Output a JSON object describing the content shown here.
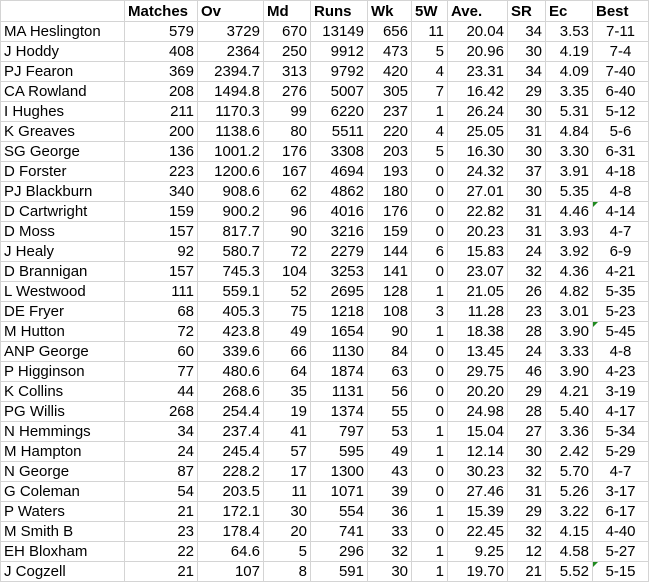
{
  "sheet": {
    "headers": [
      "",
      "Matches",
      "Ov",
      "Md",
      "Runs",
      "Wk",
      "5W",
      "Ave.",
      "SR",
      "Ec",
      "Best"
    ],
    "rows": [
      {
        "name": "MA Heslington",
        "matches": "579",
        "ov": "3729",
        "md": "670",
        "runs": "13149",
        "wk": "656",
        "fivew": "11",
        "ave": "20.04",
        "sr": "34",
        "ec": "3.53",
        "best": "7-11"
      },
      {
        "name": "J Hoddy",
        "matches": "408",
        "ov": "2364",
        "md": "250",
        "runs": "9912",
        "wk": "473",
        "fivew": "5",
        "ave": "20.96",
        "sr": "30",
        "ec": "4.19",
        "best": "7-4"
      },
      {
        "name": "PJ Fearon",
        "matches": "369",
        "ov": "2394.7",
        "md": "313",
        "runs": "9792",
        "wk": "420",
        "fivew": "4",
        "ave": "23.31",
        "sr": "34",
        "ec": "4.09",
        "best": "7-40"
      },
      {
        "name": "CA Rowland",
        "matches": "208",
        "ov": "1494.8",
        "md": "276",
        "runs": "5007",
        "wk": "305",
        "fivew": "7",
        "ave": "16.42",
        "sr": "29",
        "ec": "3.35",
        "best": "6-40"
      },
      {
        "name": "I Hughes",
        "matches": "211",
        "ov": "1170.3",
        "md": "99",
        "runs": "6220",
        "wk": "237",
        "fivew": "1",
        "ave": "26.24",
        "sr": "30",
        "ec": "5.31",
        "best": "5-12"
      },
      {
        "name": "K Greaves",
        "matches": "200",
        "ov": "1138.6",
        "md": "80",
        "runs": "5511",
        "wk": "220",
        "fivew": "4",
        "ave": "25.05",
        "sr": "31",
        "ec": "4.84",
        "best": "5-6"
      },
      {
        "name": "SG George",
        "matches": "136",
        "ov": "1001.2",
        "md": "176",
        "runs": "3308",
        "wk": "203",
        "fivew": "5",
        "ave": "16.30",
        "sr": "30",
        "ec": "3.30",
        "best": "6-31"
      },
      {
        "name": "D Forster",
        "matches": "223",
        "ov": "1200.6",
        "md": "167",
        "runs": "4694",
        "wk": "193",
        "fivew": "0",
        "ave": "24.32",
        "sr": "37",
        "ec": "3.91",
        "best": "4-18"
      },
      {
        "name": "PJ Blackburn",
        "matches": "340",
        "ov": "908.6",
        "md": "62",
        "runs": "4862",
        "wk": "180",
        "fivew": "0",
        "ave": "27.01",
        "sr": "30",
        "ec": "5.35",
        "best": "4-8"
      },
      {
        "name": "D Cartwright",
        "matches": "159",
        "ov": "900.2",
        "md": "96",
        "runs": "4016",
        "wk": "176",
        "fivew": "0",
        "ave": "22.82",
        "sr": "31",
        "ec": "4.46",
        "best": "4-14",
        "flag": true
      },
      {
        "name": "D Moss",
        "matches": "157",
        "ov": "817.7",
        "md": "90",
        "runs": "3216",
        "wk": "159",
        "fivew": "0",
        "ave": "20.23",
        "sr": "31",
        "ec": "3.93",
        "best": "4-7"
      },
      {
        "name": "J Healy",
        "matches": "92",
        "ov": "580.7",
        "md": "72",
        "runs": "2279",
        "wk": "144",
        "fivew": "6",
        "ave": "15.83",
        "sr": "24",
        "ec": "3.92",
        "best": "6-9"
      },
      {
        "name": "D Brannigan",
        "matches": "157",
        "ov": "745.3",
        "md": "104",
        "runs": "3253",
        "wk": "141",
        "fivew": "0",
        "ave": "23.07",
        "sr": "32",
        "ec": "4.36",
        "best": "4-21"
      },
      {
        "name": "L Westwood",
        "matches": "111",
        "ov": "559.1",
        "md": "52",
        "runs": "2695",
        "wk": "128",
        "fivew": "1",
        "ave": "21.05",
        "sr": "26",
        "ec": "4.82",
        "best": "5-35"
      },
      {
        "name": "DE Fryer",
        "matches": "68",
        "ov": "405.3",
        "md": "75",
        "runs": "1218",
        "wk": "108",
        "fivew": "3",
        "ave": "11.28",
        "sr": "23",
        "ec": "3.01",
        "best": "5-23"
      },
      {
        "name": "M Hutton",
        "matches": "72",
        "ov": "423.8",
        "md": "49",
        "runs": "1654",
        "wk": "90",
        "fivew": "1",
        "ave": "18.38",
        "sr": "28",
        "ec": "3.90",
        "best": "5-45",
        "flag": true
      },
      {
        "name": "ANP George",
        "matches": "60",
        "ov": "339.6",
        "md": "66",
        "runs": "1130",
        "wk": "84",
        "fivew": "0",
        "ave": "13.45",
        "sr": "24",
        "ec": "3.33",
        "best": "4-8"
      },
      {
        "name": "P Higginson",
        "matches": "77",
        "ov": "480.6",
        "md": "64",
        "runs": "1874",
        "wk": "63",
        "fivew": "0",
        "ave": "29.75",
        "sr": "46",
        "ec": "3.90",
        "best": "4-23"
      },
      {
        "name": "K Collins",
        "matches": "44",
        "ov": "268.6",
        "md": "35",
        "runs": "1131",
        "wk": "56",
        "fivew": "0",
        "ave": "20.20",
        "sr": "29",
        "ec": "4.21",
        "best": "3-19"
      },
      {
        "name": "PG Willis",
        "matches": "268",
        "ov": "254.4",
        "md": "19",
        "runs": "1374",
        "wk": "55",
        "fivew": "0",
        "ave": "24.98",
        "sr": "28",
        "ec": "5.40",
        "best": "4-17"
      },
      {
        "name": "N Hemmings",
        "matches": "34",
        "ov": "237.4",
        "md": "41",
        "runs": "797",
        "wk": "53",
        "fivew": "1",
        "ave": "15.04",
        "sr": "27",
        "ec": "3.36",
        "best": "5-34"
      },
      {
        "name": "M Hampton",
        "matches": "24",
        "ov": "245.4",
        "md": "57",
        "runs": "595",
        "wk": "49",
        "fivew": "1",
        "ave": "12.14",
        "sr": "30",
        "ec": "2.42",
        "best": "5-29"
      },
      {
        "name": "N George",
        "matches": "87",
        "ov": "228.2",
        "md": "17",
        "runs": "1300",
        "wk": "43",
        "fivew": "0",
        "ave": "30.23",
        "sr": "32",
        "ec": "5.70",
        "best": "4-7"
      },
      {
        "name": "G Coleman",
        "matches": "54",
        "ov": "203.5",
        "md": "11",
        "runs": "1071",
        "wk": "39",
        "fivew": "0",
        "ave": "27.46",
        "sr": "31",
        "ec": "5.26",
        "best": "3-17"
      },
      {
        "name": "P Waters",
        "matches": "21",
        "ov": "172.1",
        "md": "30",
        "runs": "554",
        "wk": "36",
        "fivew": "1",
        "ave": "15.39",
        "sr": "29",
        "ec": "3.22",
        "best": "6-17"
      },
      {
        "name": "M Smith B",
        "matches": "23",
        "ov": "178.4",
        "md": "20",
        "runs": "741",
        "wk": "33",
        "fivew": "0",
        "ave": "22.45",
        "sr": "32",
        "ec": "4.15",
        "best": "4-40"
      },
      {
        "name": "EH Bloxham",
        "matches": "22",
        "ov": "64.6",
        "md": "5",
        "runs": "296",
        "wk": "32",
        "fivew": "1",
        "ave": "9.25",
        "sr": "12",
        "ec": "4.58",
        "best": "5-27"
      },
      {
        "name": "J Cogzell",
        "matches": "21",
        "ov": "107",
        "md": "8",
        "runs": "591",
        "wk": "30",
        "fivew": "1",
        "ave": "19.70",
        "sr": "21",
        "ec": "5.52",
        "best": "5-15",
        "flag": true
      }
    ],
    "flag_color": "#1f8a1f",
    "grid_color": "#d4d4d4"
  }
}
